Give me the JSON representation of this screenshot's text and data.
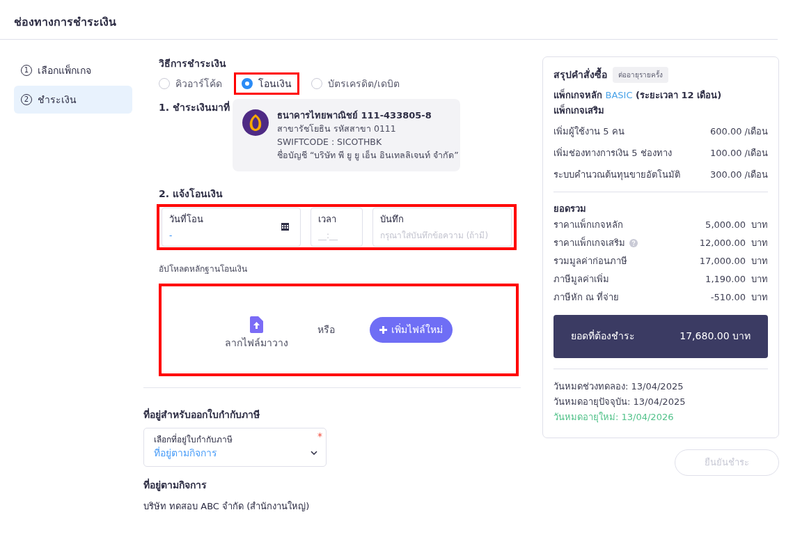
{
  "header": {
    "title": "ช่องทางการชำระเงิน"
  },
  "steps": [
    {
      "number": "1",
      "label": "เลือกแพ็กเกจ",
      "selected": false
    },
    {
      "number": "2",
      "label": "ชำระเงิน",
      "selected": true
    }
  ],
  "payment_method": {
    "label": "วิธีการชำระเงิน",
    "options": [
      {
        "label": "คิวอาร์โค้ด",
        "selected": false,
        "highlighted": false
      },
      {
        "label": "โอนเงิน",
        "selected": true,
        "highlighted": true
      },
      {
        "label": "บัตรเครดิต/เดบิต",
        "selected": false,
        "highlighted": false
      }
    ]
  },
  "pay_to": {
    "label": "1. ชำระเงินมาที่",
    "bank_name": "ธนาคารไทยพาณิชย์ 111-433805-8",
    "lines": [
      "สาขารัชโยธิน รหัสสาขา 0111",
      "SWIFTCODE : SICOTHBK",
      "ชื่อบัญชี “บริษัท พี ยู ยู เอ็น อินเทลลิเจนท์ จำกัด”"
    ]
  },
  "notify": {
    "label": "2. แจ้งโอนเงิน",
    "highlighted": true,
    "fields": [
      {
        "kind": "date",
        "label": "วันที่โอน",
        "value": "-"
      },
      {
        "kind": "time",
        "label": "เวลา",
        "placeholder": "__:__"
      },
      {
        "kind": "text",
        "label": "บันทึก",
        "placeholder": "กรุณาใส่บันทึกข้อความ (ถ้ามี)"
      }
    ]
  },
  "upload": {
    "label": "อัปโหลดหลักฐานโอนเงิน",
    "highlighted": true,
    "drop_text": "ลากไฟล์มาวาง",
    "or_text": "หรือ",
    "button": "เพิ่มไฟล์ใหม่"
  },
  "tax_address": {
    "title": "ที่อยู่สำหรับออกใบกำกับภาษี",
    "select": {
      "label": "เลือกที่อยู่ใบกำกับภาษี",
      "value": "ที่อยู่ตามกิจการ",
      "required_mark": "*"
    },
    "address_title": "ที่อยู่ตามกิจการ",
    "address": "บริษัท ทดสอบ ABC จำกัด (สำนักงานใหญ่)"
  },
  "summary": {
    "title": "สรุปคำสั่งซื้อ",
    "badge": "ต่ออายุรายครั้ง",
    "main_package": {
      "prefix": "แพ็กเกจหลัก",
      "plan": "BASIC",
      "suffix": "(ระยะเวลา 12 เดือน)"
    },
    "addons_title": "แพ็กเกจเสริม",
    "addons": [
      {
        "name": "เพิ่มผู้ใช้งาน 5 คน",
        "price": "600.00 /เดือน"
      },
      {
        "name": "เพิ่มช่องทางการเงิน 5 ช่องทาง",
        "price": "100.00 /เดือน"
      },
      {
        "name": "ระบบคำนวณต้นทุนขายอัตโนมัติ",
        "price": "300.00 /เดือน"
      }
    ],
    "total_title": "ยอดรวม",
    "totals": [
      {
        "label": "ราคาแพ็กเกจหลัก",
        "amount": "5,000.00",
        "unit": "บาท",
        "info": false
      },
      {
        "label": "ราคาแพ็กเกจเสริม",
        "amount": "12,000.00",
        "unit": "บาท",
        "info": true
      },
      {
        "label": "รวมมูลค่าก่อนภาษี",
        "amount": "17,000.00",
        "unit": "บาท",
        "info": false
      },
      {
        "label": "ภาษีมูลค่าเพิ่ม",
        "amount": "1,190.00",
        "unit": "บาท",
        "info": false
      },
      {
        "label": "ภาษีหัก ณ ที่จ่าย",
        "amount": "-510.00",
        "unit": "บาท",
        "info": false
      }
    ],
    "due": {
      "label": "ยอดที่ต้องชำระ",
      "amount": "17,680.00 บาท"
    },
    "dates": [
      {
        "text": "วันหมดช่วงทดลอง: 13/04/2025",
        "highlight": false
      },
      {
        "text": "วันหมดอายุปัจจุบัน: 13/04/2025",
        "highlight": false
      },
      {
        "text": "วันหมดอายุใหม่: 13/04/2026",
        "highlight": true
      }
    ]
  },
  "confirm_button": {
    "label": "ยืนยันชำระ",
    "disabled": true
  }
}
